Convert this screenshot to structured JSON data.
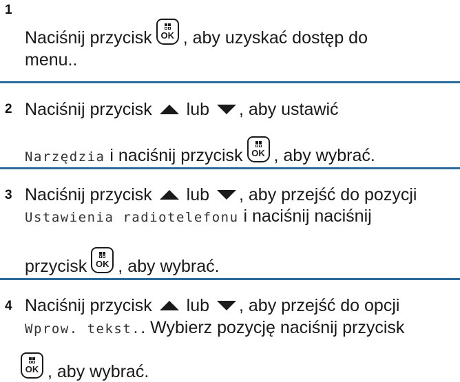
{
  "button_label": "OK",
  "colors": {
    "separator": "#2b6a9b",
    "text": "#1a1a1a"
  },
  "icons": [
    "ok-menu-button-icon",
    "up-arrow-icon",
    "down-arrow-icon"
  ],
  "steps": [
    {
      "number": "1",
      "press": "Naciśnij przycisk",
      "after_button": ", aby uzyskać dostęp do",
      "line2": "menu.."
    },
    {
      "number": "2",
      "press": "Naciśnij przycisk",
      "or": "lub",
      "after_arrows": ", aby ustawić",
      "menu_item": "Narzędzia",
      "press2": "i naciśnij przycisk",
      "select": ", aby wybrać."
    },
    {
      "number": "3",
      "press": "Naciśnij przycisk",
      "or": "lub",
      "after_arrows": ", aby przejść do pozycji",
      "menu_item": "Ustawienia radiotelefonu",
      "press2": "i naciśnij naciśnij",
      "line3": "przycisk",
      "select": ", aby wybrać."
    },
    {
      "number": "4",
      "press": "Naciśnij przycisk",
      "or": "lub",
      "after_arrows": ", aby przejść do opcji",
      "menu_item": "Wprow. tekst.",
      "after_item": ". Wybierz pozycję naciśnij przycisk",
      "select": ", aby wybrać."
    }
  ]
}
